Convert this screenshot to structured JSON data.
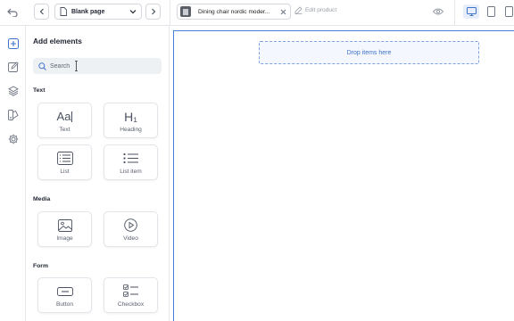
{
  "topbar": {
    "page_select": "Blank page",
    "product_tab": "Dining chair nordic moder...",
    "edit_product": "Edit product"
  },
  "panel": {
    "title": "Add elements",
    "search_placeholder": "Search",
    "sections": {
      "text": {
        "label": "Text",
        "items": [
          "Text",
          "Heading",
          "List",
          "List item"
        ]
      },
      "media": {
        "label": "Media",
        "items": [
          "Image",
          "Video"
        ]
      },
      "form": {
        "label": "Form",
        "items": [
          "Button",
          "Checkbox"
        ]
      }
    },
    "glyphs": {
      "text": "Aa",
      "heading": "H₁"
    }
  },
  "canvas": {
    "dropzone": "Drop items here"
  },
  "colors": {
    "accent": "#3f73c8",
    "canvas_border": "#4a7fd8",
    "dropzone_bg": "#f4f7fd",
    "active_device_bg": "#e7eefb"
  },
  "icons": {
    "topbar": [
      "undo-icon",
      "chevron-left-icon",
      "page-icon",
      "chevron-down-icon",
      "chevron-right-icon",
      "product-thumbnail",
      "close-icon",
      "edit-icon",
      "eye-icon",
      "desktop-icon",
      "tablet-icon",
      "mobile-icon"
    ],
    "rail": [
      "add-icon",
      "edit-icon",
      "layers-icon",
      "theme-icon",
      "gear-icon"
    ]
  }
}
